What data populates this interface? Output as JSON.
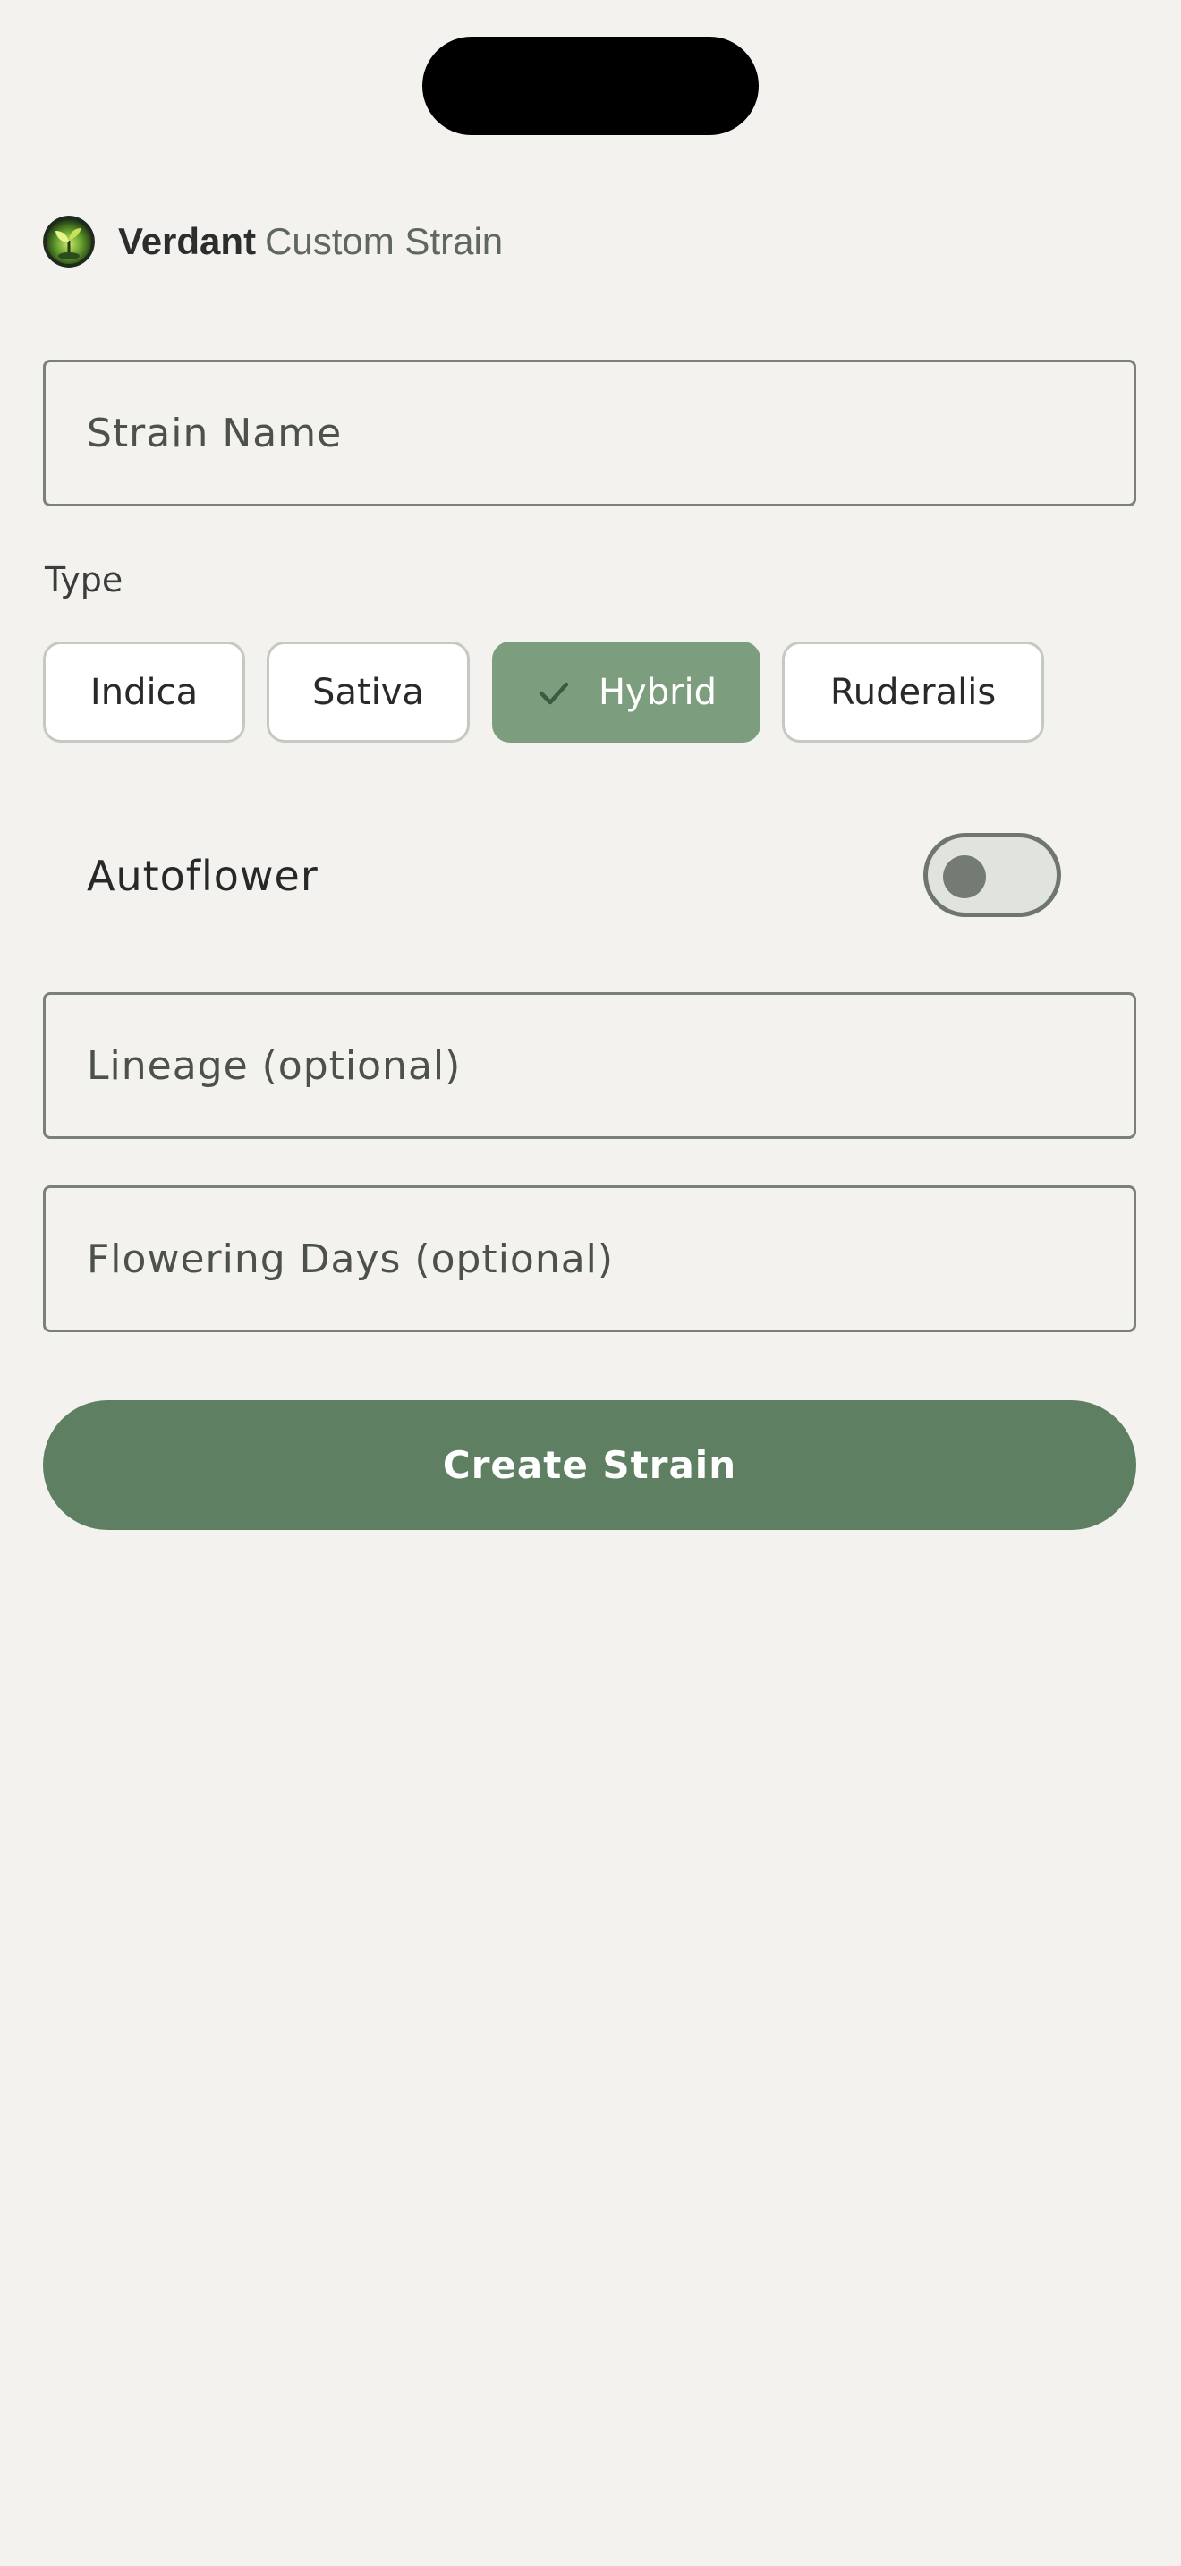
{
  "brand": {
    "name": "Verdant",
    "subtitle": "Custom Strain",
    "logo_icon": "sprout-logo-icon"
  },
  "form": {
    "strain_name_placeholder": "Strain Name",
    "type_label": "Type",
    "types": [
      {
        "label": "Indica",
        "selected": false
      },
      {
        "label": "Sativa",
        "selected": false
      },
      {
        "label": "Hybrid",
        "selected": true
      },
      {
        "label": "Ruderalis",
        "selected": false
      }
    ],
    "autoflower_label": "Autoflower",
    "autoflower_on": false,
    "lineage_placeholder": "Lineage (optional)",
    "flowering_days_placeholder": "Flowering Days (optional)",
    "submit_label": "Create Strain"
  },
  "colors": {
    "background": "#f3f2ee",
    "accent": "#5f7f63",
    "chip_selected": "#7d9e7e",
    "field_border": "#7c807a"
  }
}
